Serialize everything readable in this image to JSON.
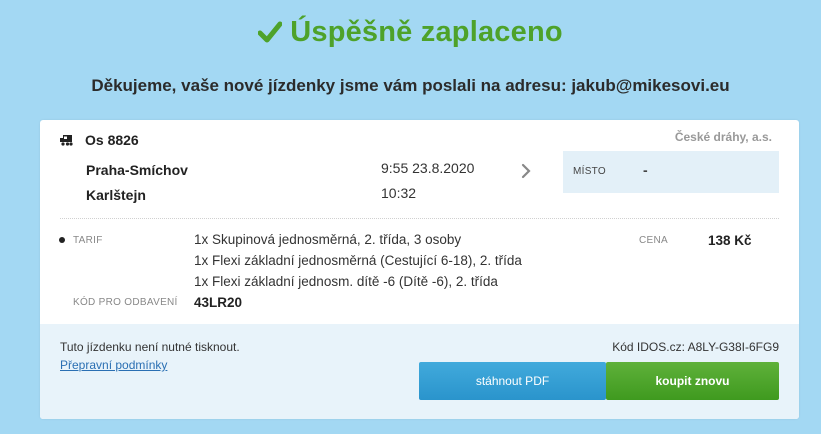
{
  "header": {
    "title": "Úspěšně zaplaceno",
    "icon": "check-icon",
    "thanks": "Děkujeme, vaše nové jízdenky jsme vám poslali na adresu: jakub@mikesovi.eu"
  },
  "ticket": {
    "train": "Os 8826",
    "train_icon": "train-icon",
    "carrier": "České dráhy, a.s.",
    "from_station": "Praha-Smíchov",
    "to_station": "Karlštejn",
    "departure": "9:55 23.8.2020",
    "arrival": "10:32",
    "seat_label": "MÍSTO",
    "seat_value": "-",
    "tarif_label": "TARIF",
    "tarifs": [
      "1x Skupinová jednosměrná, 2. třída, 3 osoby",
      "1x Flexi základní jednosměrná (Cestující 6-18), 2. třída",
      "1x Flexi základní jednosm. dítě -6 (Dítě -6), 2. třída"
    ],
    "price_label": "CENA",
    "price_value": "138 Kč",
    "code_label": "KÓD PRO ODBAVENÍ",
    "code_value": "43LR20"
  },
  "footer": {
    "no_print": "Tuto jízdenku není nutné tisknout.",
    "conditions_link": "Přepravní podmínky",
    "idos_code": "Kód IDOS.cz: A8LY-G38I-6FG9",
    "pdf_button": "stáhnout PDF",
    "buy_button": "koupit znovu"
  },
  "colors": {
    "background": "#a3d8f3",
    "success": "#4ea22a",
    "pdf_button": "#2a94cc",
    "buy_button": "#4ea22a",
    "link": "#2a6fb3"
  }
}
